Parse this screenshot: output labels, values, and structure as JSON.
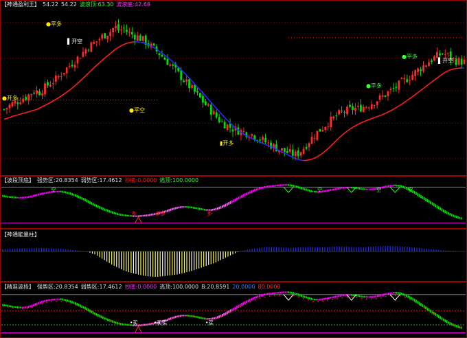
{
  "colors": {
    "background": "#000000",
    "frame": "#a00000",
    "up": "#ff2a2a",
    "down": "#00dd00",
    "ma_red": "#ff2020",
    "ma_blue": "#2030ff",
    "magenta": "#ff00ff",
    "yellow": "#ffff33",
    "blue_bar": "#2828ff",
    "white": "#ffffff",
    "label_yellow": "#ffee00",
    "label_green": "#33ff33"
  },
  "panels": {
    "main": {
      "title": "【神通盈利王】",
      "values": [
        {
          "text": "54.22",
          "color": "#e0e0e0"
        },
        {
          "text": "54.22",
          "color": "#e0e0e0"
        },
        {
          "text": "波浪顶:63.30",
          "color": "#33ff33"
        },
        {
          "text": "波浪底:42.68",
          "color": "#ff33ff"
        }
      ]
    },
    "wave": {
      "title": "【波段顶底】",
      "values": [
        {
          "text": "强势区:20.8354",
          "color": "#e0e0e0"
        },
        {
          "text": "弱势区:17.4612",
          "color": "#e0e0e0"
        },
        {
          "text": "抄底:0.0000",
          "color": "#ff2020"
        },
        {
          "text": "逃顶:100.0000",
          "color": "#33ff33"
        }
      ]
    },
    "energy": {
      "title": "【神通能量柱】",
      "values": []
    },
    "precise": {
      "title": "【精准波段】",
      "values": [
        {
          "text": "强势区:20.8354",
          "color": "#e0e0e0"
        },
        {
          "text": "弱势区:17.4612",
          "color": "#e0e0e0"
        },
        {
          "text": "抄底:0.0000",
          "color": "#ff33ff"
        },
        {
          "text": "逃顶:100.0000",
          "color": "#e0e0e0"
        },
        {
          "text": "B:20.8591",
          "color": "#e0e0e0"
        },
        {
          "text": "20.0000",
          "color": "#3080ff"
        },
        {
          "text": "80.0000",
          "color": "#ff3030"
        }
      ]
    }
  },
  "chart_data": [
    {
      "type": "candlestick",
      "name": "main",
      "ylim": [
        40,
        66
      ],
      "closes": [
        50,
        50.5,
        51,
        51.3,
        51.8,
        52,
        52.6,
        53,
        52.8,
        53.4,
        54,
        54.5,
        55,
        55.8,
        56.5,
        57.2,
        57.8,
        58.5,
        59.3,
        60,
        60.5,
        61,
        61.6,
        62.1,
        62.5,
        63.3,
        62.6,
        63,
        62.3,
        62,
        61.7,
        61.3,
        60.8,
        60.2,
        59.6,
        59,
        58.3,
        57.6,
        56.8,
        56,
        55.2,
        54.4,
        53.6,
        52.8,
        52,
        51.2,
        50.4,
        49.6,
        48.8,
        48,
        47.6,
        47.2,
        46.8,
        46.6,
        46.4,
        46.2,
        46,
        45.6,
        45.2,
        44.8,
        44.4,
        44,
        43.7,
        43.4,
        43.1,
        42.9,
        42.68,
        43.3,
        44.1,
        45,
        45.8,
        46.5,
        47.1,
        47.8,
        48.3,
        48.9,
        49.4,
        49.7,
        49.9,
        50.2,
        50.1,
        50.4,
        50.6,
        51,
        51.4,
        51.8,
        52.3,
        52.8,
        53.3,
        53.8,
        54.4,
        54.9,
        55.4,
        56,
        56.6,
        57.1,
        57.7,
        58.2,
        58.6,
        59,
        58.8,
        58.2,
        57.8,
        57.7,
        57.6
      ],
      "marks": [
        {
          "text": "●开多",
          "x": 3,
          "price": 51.5,
          "color": "#ffee00"
        },
        {
          "text": "●平多",
          "x": 67,
          "price": 63.4,
          "color": "#ffee00"
        },
        {
          "text": "▌开空",
          "x": 98,
          "price": 60.6,
          "color": "#ffffff"
        },
        {
          "text": "●平空",
          "x": 188,
          "price": 49.6,
          "color": "#ffee00"
        },
        {
          "text": "▮开多",
          "x": 320,
          "price": 44.3,
          "color": "#ffee00"
        },
        {
          "text": "●平多",
          "x": 533,
          "price": 53.5,
          "color": "#33ff33"
        },
        {
          "text": "●平多",
          "x": 585,
          "price": 58.2,
          "color": "#33ff33"
        },
        {
          "text": "▌开空",
          "x": 638,
          "price": 57.5,
          "color": "#ffffff"
        }
      ]
    },
    {
      "type": "oscillator",
      "name": "wave",
      "ylim": [
        0,
        100
      ],
      "values": [
        70,
        68,
        67,
        66,
        66,
        67,
        69,
        72,
        75,
        77,
        79,
        80,
        80,
        78,
        75,
        71,
        66,
        61,
        55,
        49,
        44,
        39,
        35,
        31,
        28,
        26,
        25,
        24,
        24,
        25,
        26,
        28,
        30,
        33,
        36,
        40,
        43,
        45,
        45,
        44,
        42,
        40,
        38,
        38,
        40,
        44,
        49,
        55,
        61,
        67,
        73,
        78,
        83,
        87,
        90,
        92,
        93,
        94,
        95,
        95,
        93,
        90,
        86,
        83,
        80,
        79,
        80,
        82,
        84,
        86,
        88,
        89,
        89,
        88,
        86,
        85,
        85,
        86,
        88,
        91,
        93,
        94,
        93,
        89,
        84,
        78,
        71,
        64,
        57,
        50,
        43,
        36,
        30,
        25,
        21,
        18
      ],
      "marks": [
        {
          "text": "空",
          "x": 74,
          "color": "#33ff33"
        },
        {
          "text": "多",
          "x": 191,
          "color": "#ff2020"
        },
        {
          "text": "多多",
          "x": 226,
          "color": "#ff2020"
        },
        {
          "text": "多",
          "x": 301,
          "color": "#ff2020"
        },
        {
          "text": "空",
          "x": 462,
          "color": "#33ff33"
        },
        {
          "text": "空",
          "x": 548,
          "color": "#33ff33"
        },
        {
          "text": "空",
          "x": 594,
          "color": "#33ff33"
        }
      ]
    },
    {
      "type": "bar",
      "name": "energy",
      "ylim": [
        -100,
        100
      ],
      "values": [
        18,
        20,
        22,
        24,
        26,
        26,
        27,
        28,
        28,
        27,
        26,
        24,
        22,
        18,
        14,
        10,
        6,
        2,
        -4,
        -10,
        -20,
        -30,
        -40,
        -50,
        -58,
        -66,
        -72,
        -76,
        -80,
        -84,
        -86,
        -88,
        -88,
        -86,
        -84,
        -82,
        -80,
        -76,
        -72,
        -68,
        -62,
        -56,
        -50,
        -44,
        -38,
        -30,
        -22,
        -14,
        -6,
        2,
        10,
        18,
        24,
        30,
        34,
        36,
        36,
        34,
        32,
        30,
        30,
        32,
        34,
        36,
        36,
        34,
        34,
        36,
        38,
        40,
        40,
        38,
        36,
        34,
        34,
        36,
        38,
        40,
        42,
        44,
        44,
        42,
        40,
        38,
        36,
        32,
        28,
        24,
        20,
        16,
        12,
        8,
        6,
        4,
        2,
        1
      ]
    },
    {
      "type": "oscillator",
      "name": "precise",
      "ylim": [
        0,
        100
      ],
      "values": [
        68,
        66,
        64,
        63,
        62,
        63,
        66,
        70,
        74,
        77,
        79,
        80,
        80,
        78,
        75,
        71,
        66,
        61,
        55,
        49,
        44,
        39,
        35,
        31,
        28,
        26,
        25,
        24,
        24,
        25,
        26,
        28,
        30,
        33,
        36,
        40,
        43,
        45,
        45,
        44,
        42,
        40,
        38,
        38,
        40,
        44,
        49,
        55,
        61,
        67,
        73,
        78,
        83,
        87,
        90,
        92,
        93,
        94,
        95,
        95,
        93,
        90,
        86,
        83,
        80,
        79,
        80,
        82,
        84,
        86,
        88,
        89,
        89,
        88,
        86,
        85,
        85,
        86,
        88,
        91,
        93,
        94,
        93,
        89,
        84,
        78,
        71,
        64,
        57,
        50,
        43,
        36,
        30,
        25,
        21,
        18
      ],
      "marks": [
        {
          "text": "•买",
          "x": 189,
          "color": "#ffffff"
        },
        {
          "text": "•买买",
          "x": 224,
          "color": "#ffffff"
        },
        {
          "text": "•买",
          "x": 299,
          "color": "#ffffff"
        }
      ]
    }
  ]
}
